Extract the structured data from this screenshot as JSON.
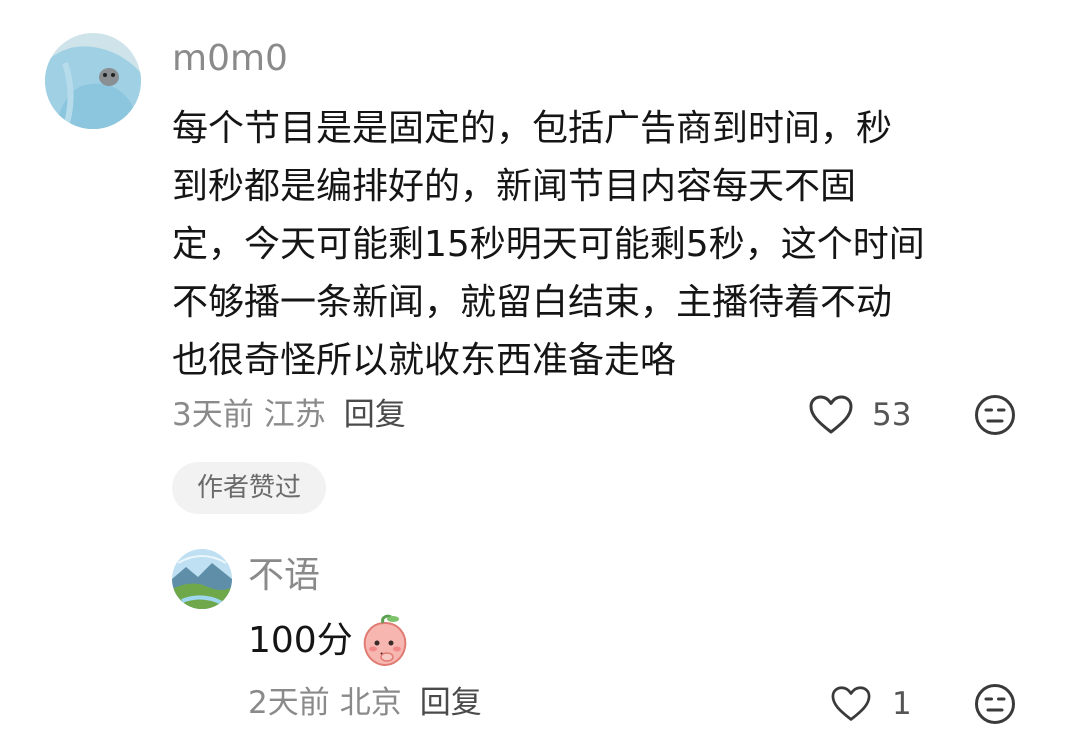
{
  "main_comment": {
    "username": "m0m0",
    "lines": [
      "每个节目是是固定的，包括广告商到时间，秒",
      "到秒都是编排好的，新闻节目内容每天不固",
      "定，今天可能剩15秒明天可能剩5秒，这个时间",
      "不够播一条新闻，就留白结束，主播待着不动",
      "也很奇怪所以就收东西准备走咯"
    ],
    "time": "3天前",
    "location": "江苏",
    "reply_label": "回复",
    "like_count": "53",
    "author_liked_tag": "作者赞过",
    "like_icon": "heart-outline-icon",
    "emoji_icon": "neutral-face-icon"
  },
  "reply_comment": {
    "username": "不语",
    "text": "100分",
    "sticker": "peach-face-sticker",
    "time": "2天前",
    "location": "北京",
    "reply_label": "回复",
    "like_count": "1",
    "like_icon": "heart-outline-icon",
    "emoji_icon": "neutral-face-icon"
  },
  "colors": {
    "text_primary": "#151515",
    "text_secondary": "#8a8a8a",
    "tag_background": "#f2f2f2"
  }
}
